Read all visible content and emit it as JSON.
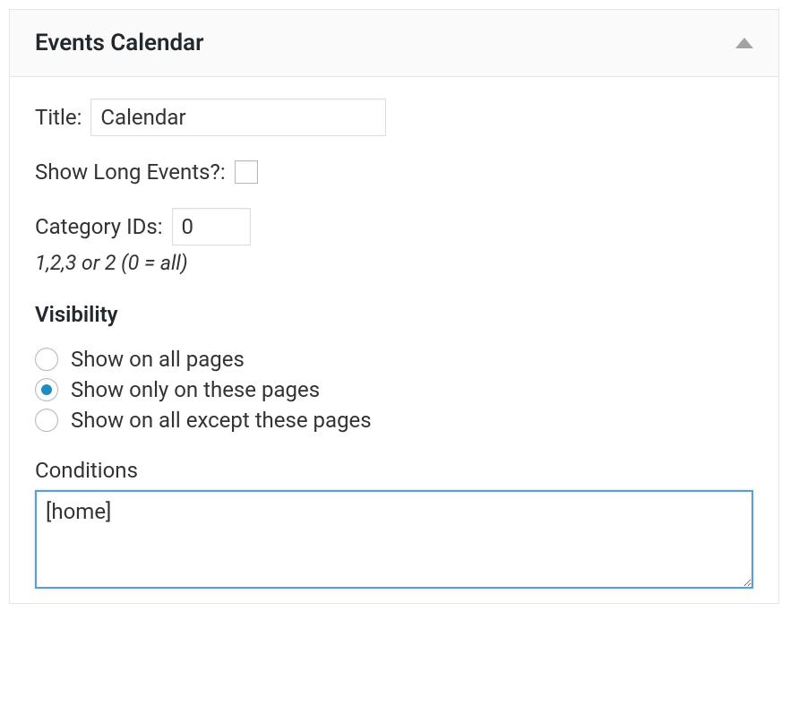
{
  "widget": {
    "title": "Events Calendar"
  },
  "fields": {
    "title_label": "Title:",
    "title_value": "Calendar",
    "show_long_events_label": "Show Long Events?:",
    "category_ids_label": "Category IDs:",
    "category_ids_value": "0",
    "category_ids_hint": "1,2,3 or 2 (0 = all)"
  },
  "visibility": {
    "heading": "Visibility",
    "options": [
      {
        "label": "Show on all pages",
        "checked": false
      },
      {
        "label": "Show only on these pages",
        "checked": true
      },
      {
        "label": "Show on all except these pages",
        "checked": false
      }
    ]
  },
  "conditions": {
    "label": "Conditions",
    "value": "[home]"
  }
}
